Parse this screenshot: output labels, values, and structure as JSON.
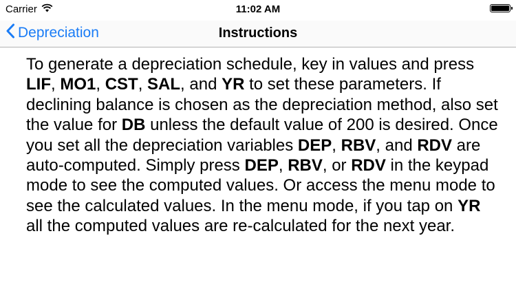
{
  "status_bar": {
    "carrier": "Carrier",
    "time": "11:02 AM"
  },
  "nav": {
    "back_label": "Depreciation",
    "title": "Instructions"
  },
  "instructions": [
    {
      "text": "To generate a depreciation schedule, key in values and press ",
      "bold": false
    },
    {
      "text": "LIF",
      "bold": true
    },
    {
      "text": ", ",
      "bold": false
    },
    {
      "text": "MO1",
      "bold": true
    },
    {
      "text": ", ",
      "bold": false
    },
    {
      "text": "CST",
      "bold": true
    },
    {
      "text": ", ",
      "bold": false
    },
    {
      "text": "SAL",
      "bold": true
    },
    {
      "text": ", and ",
      "bold": false
    },
    {
      "text": "YR",
      "bold": true
    },
    {
      "text": " to set these parameters. If declining balance is chosen as the depreciation method, also set the value for ",
      "bold": false
    },
    {
      "text": "DB",
      "bold": true
    },
    {
      "text": " unless the default value of 200 is desired. Once you set all the depreciation variables ",
      "bold": false
    },
    {
      "text": "DEP",
      "bold": true
    },
    {
      "text": ", ",
      "bold": false
    },
    {
      "text": "RBV",
      "bold": true
    },
    {
      "text": ", and ",
      "bold": false
    },
    {
      "text": "RDV",
      "bold": true
    },
    {
      "text": " are auto-computed. Simply press ",
      "bold": false
    },
    {
      "text": "DEP",
      "bold": true
    },
    {
      "text": ", ",
      "bold": false
    },
    {
      "text": "RBV",
      "bold": true
    },
    {
      "text": ", or ",
      "bold": false
    },
    {
      "text": "RDV",
      "bold": true
    },
    {
      "text": " in the keypad mode to see the computed values. Or access the menu mode to see the calculated values. In the menu mode, if you tap on ",
      "bold": false
    },
    {
      "text": "YR",
      "bold": true
    },
    {
      "text": " all the computed values are re-calculated for the next year.",
      "bold": false
    }
  ]
}
